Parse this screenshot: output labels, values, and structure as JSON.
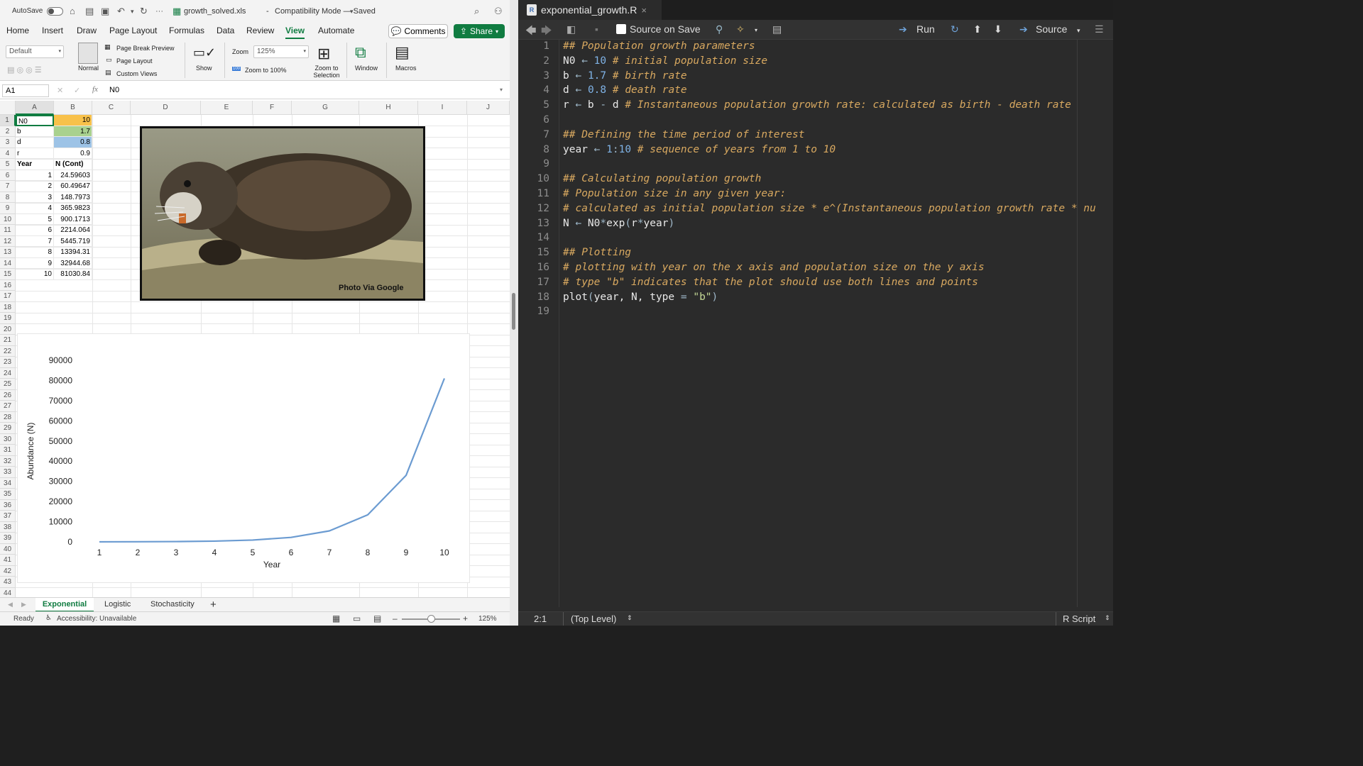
{
  "excel": {
    "autosave_label": "AutoSave",
    "filename": "growth_solved.xls",
    "mode": "Compatibility Mode — Saved",
    "title_sep": "-",
    "ellipsis": "···",
    "tabs": [
      "Home",
      "Insert",
      "Draw",
      "Page Layout",
      "Formulas",
      "Data",
      "Review",
      "View",
      "Automate"
    ],
    "active_tab": "View",
    "comments_label": "Comments",
    "share_label": "Share",
    "ribbon": {
      "style_select": "Default",
      "normal_label": "Normal",
      "page_break_preview": "Page Break Preview",
      "page_layout": "Page Layout",
      "custom_views": "Custom Views",
      "show_label": "Show",
      "zoom_label": "Zoom",
      "zoom_value": "125%",
      "zoom_100_icon_text": "100",
      "zoom_100": "Zoom to 100%",
      "zoom_selection_1": "Zoom to",
      "zoom_selection_2": "Selection",
      "window_label": "Window",
      "macros_label": "Macros"
    },
    "name_box": "A1",
    "formula_value": "N0",
    "fx_label": "fx",
    "columns": [
      "A",
      "B",
      "C",
      "D",
      "E",
      "F",
      "G",
      "H",
      "I",
      "J"
    ],
    "rows": [
      "1",
      "2",
      "3",
      "4",
      "5",
      "6",
      "7",
      "8",
      "9",
      "10",
      "11",
      "12",
      "13",
      "14",
      "15",
      "16",
      "17",
      "18",
      "19",
      "20",
      "21",
      "22",
      "23",
      "24",
      "25",
      "26",
      "27",
      "28",
      "29",
      "30",
      "31",
      "32",
      "33",
      "34",
      "35",
      "36",
      "37",
      "38",
      "39",
      "40",
      "41",
      "42",
      "43",
      "44"
    ],
    "cells": {
      "A1": "N0",
      "B1": "10",
      "A2": "b",
      "B2": "1.7",
      "A3": "d",
      "B3": "0.8",
      "A4": "r",
      "B4": "0.9",
      "A5": "Year",
      "B5": "N (Cont)",
      "A6": "1",
      "B6": "24.59603",
      "A7": "2",
      "B7": "60.49647",
      "A8": "3",
      "B8": "148.7973",
      "A9": "4",
      "B9": "365.9823",
      "A10": "5",
      "B10": "900.1713",
      "A11": "6",
      "B11": "2214.064",
      "A12": "7",
      "B12": "5445.719",
      "A13": "8",
      "B13": "13394.31",
      "A14": "9",
      "B14": "32944.68",
      "A15": "10",
      "B15": "81030.84"
    },
    "highlight_colors": {
      "B1": "#f8c14a",
      "B2": "#a9d18e",
      "B3": "#9dc3e6"
    },
    "photo_caption": "Photo Via Google",
    "sheet_tabs": [
      "Exponential",
      "Logistic",
      "Stochasticity"
    ],
    "active_sheet": "Exponential",
    "add_sheet": "+",
    "status_ready": "Ready",
    "accessibility": "Accessibility: Unavailable",
    "status_zoom": "125%",
    "zoom_minus": "–",
    "zoom_plus": "+",
    "accent": "#107c41"
  },
  "chart_data": {
    "type": "line",
    "x": [
      1,
      2,
      3,
      4,
      5,
      6,
      7,
      8,
      9,
      10
    ],
    "series": [
      {
        "values": [
          24.59603,
          60.49647,
          148.7973,
          365.9823,
          900.1713,
          2214.064,
          5445.719,
          13394.31,
          32944.68,
          81030.84
        ]
      }
    ],
    "xlabel": "Year",
    "ylabel": "Abundance (N)",
    "ylim": [
      0,
      90000
    ],
    "yticks": [
      0,
      10000,
      20000,
      30000,
      40000,
      50000,
      60000,
      70000,
      80000,
      90000
    ],
    "xticks": [
      1,
      2,
      3,
      4,
      5,
      6,
      7,
      8,
      9,
      10
    ],
    "grid": false,
    "line_color": "#6b9bd1"
  },
  "rstudio": {
    "tab_title": "exponential_growth.R",
    "tab_icon_letter": "R",
    "close_icon_text": "×",
    "source_on_save": "Source on Save",
    "run_label": "Run",
    "source_label": "Source",
    "status_position": "2:1",
    "status_scope": "(Top Level)",
    "status_filetype": "R Script",
    "lines": [
      [
        {
          "t": "## Population growth parameters",
          "c": "cm"
        }
      ],
      [
        {
          "t": "N0 ",
          "c": ""
        },
        {
          "t": "←",
          "c": "op"
        },
        {
          "t": " ",
          "c": ""
        },
        {
          "t": "10",
          "c": "nm"
        },
        {
          "t": " # initial population size",
          "c": "cm"
        }
      ],
      [
        {
          "t": "b ",
          "c": ""
        },
        {
          "t": "←",
          "c": "op"
        },
        {
          "t": " ",
          "c": ""
        },
        {
          "t": "1.7",
          "c": "nm"
        },
        {
          "t": " # birth rate",
          "c": "cm"
        }
      ],
      [
        {
          "t": "d ",
          "c": ""
        },
        {
          "t": "←",
          "c": "op"
        },
        {
          "t": " ",
          "c": ""
        },
        {
          "t": "0.8",
          "c": "nm"
        },
        {
          "t": " # death rate",
          "c": "cm"
        }
      ],
      [
        {
          "t": "r ",
          "c": ""
        },
        {
          "t": "←",
          "c": "op"
        },
        {
          "t": " b ",
          "c": ""
        },
        {
          "t": "-",
          "c": "op"
        },
        {
          "t": " d ",
          "c": ""
        },
        {
          "t": "# Instantaneous population growth rate: calculated as birth - death rate",
          "c": "cm"
        }
      ],
      [],
      [
        {
          "t": "## Defining the time period of interest",
          "c": "cm"
        }
      ],
      [
        {
          "t": "year ",
          "c": ""
        },
        {
          "t": "←",
          "c": "op"
        },
        {
          "t": " ",
          "c": ""
        },
        {
          "t": "1",
          "c": "nm"
        },
        {
          "t": ":",
          "c": "op"
        },
        {
          "t": "10",
          "c": "nm"
        },
        {
          "t": " # sequence of years from 1 to 10",
          "c": "cm"
        }
      ],
      [],
      [
        {
          "t": "## Calculating population growth",
          "c": "cm"
        }
      ],
      [
        {
          "t": "# Population size in any given year:",
          "c": "cm"
        }
      ],
      [
        {
          "t": "# calculated as initial population size * e^(Instantaneous population growth rate * nu",
          "c": "cm"
        }
      ],
      [
        {
          "t": "N ",
          "c": ""
        },
        {
          "t": "←",
          "c": "op"
        },
        {
          "t": " N0",
          "c": ""
        },
        {
          "t": "*",
          "c": "op"
        },
        {
          "t": "exp",
          "c": ""
        },
        {
          "t": "(",
          "c": "op"
        },
        {
          "t": "r",
          "c": ""
        },
        {
          "t": "*",
          "c": "op"
        },
        {
          "t": "year",
          "c": ""
        },
        {
          "t": ")",
          "c": "op"
        }
      ],
      [],
      [
        {
          "t": "## Plotting",
          "c": "cm"
        }
      ],
      [
        {
          "t": "# plotting with year on the x axis and population size on the y axis",
          "c": "cm"
        }
      ],
      [
        {
          "t": "# type \"b\" indicates that the plot should use both lines and points",
          "c": "cm"
        }
      ],
      [
        {
          "t": "plot",
          "c": ""
        },
        {
          "t": "(",
          "c": "op"
        },
        {
          "t": "year, N, type ",
          "c": ""
        },
        {
          "t": "=",
          "c": "op"
        },
        {
          "t": " ",
          "c": ""
        },
        {
          "t": "\"b\"",
          "c": "st"
        },
        {
          "t": ")",
          "c": "op"
        }
      ],
      []
    ]
  }
}
